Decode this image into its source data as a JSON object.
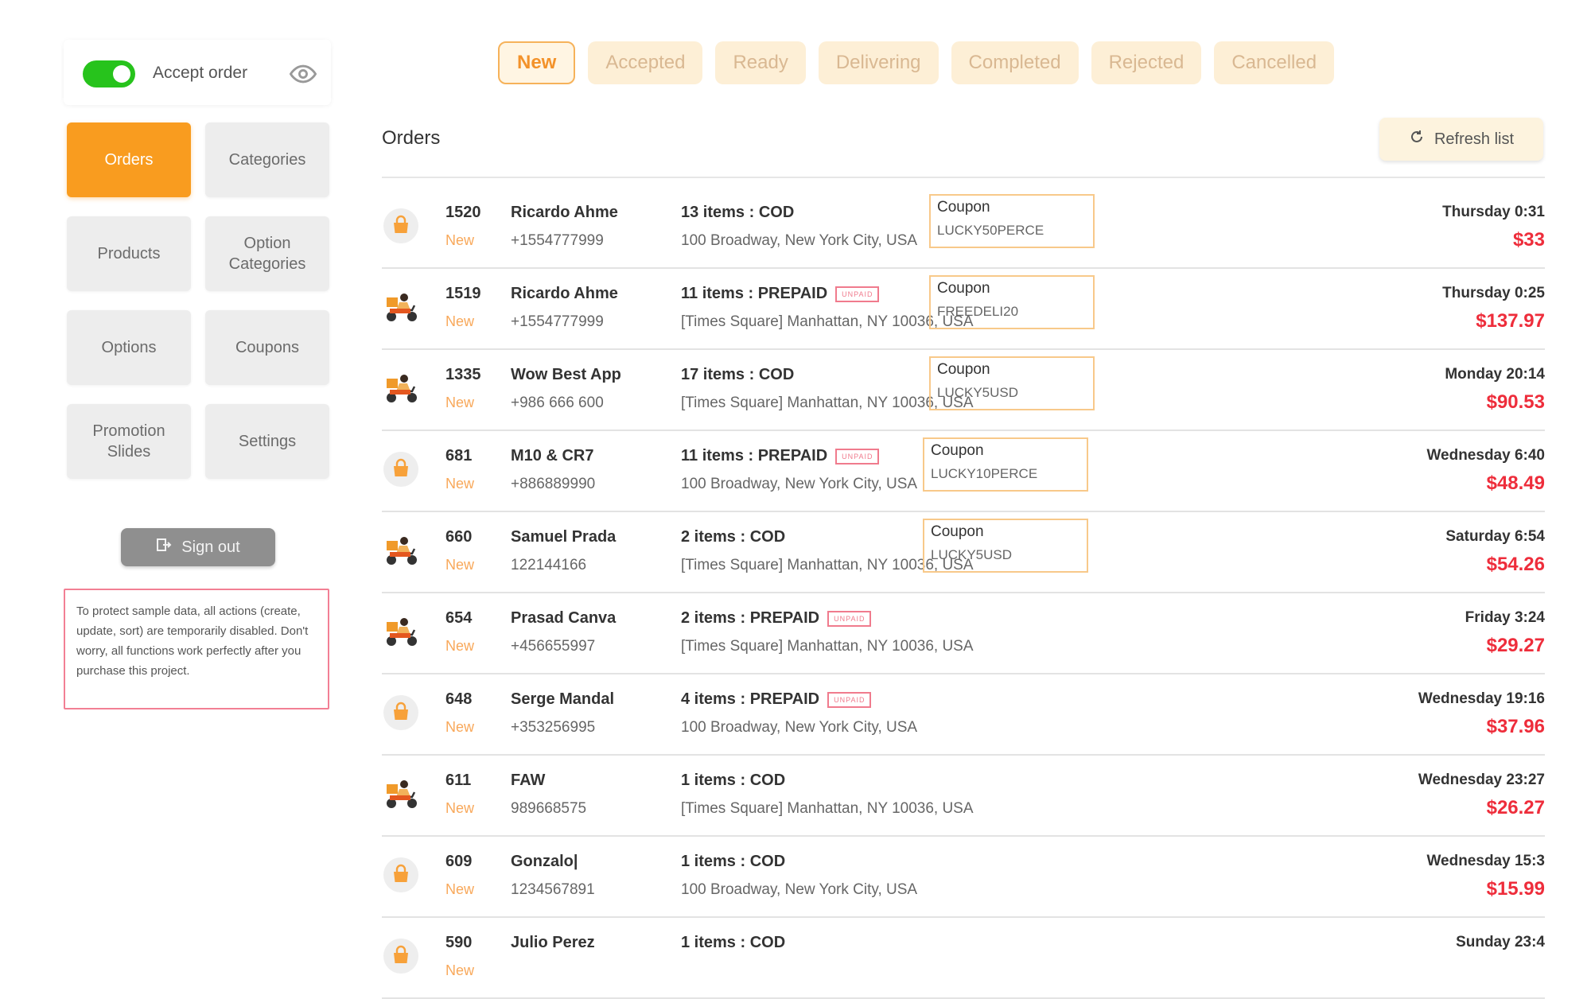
{
  "sidebar": {
    "accept_label": "Accept order",
    "accept_on": true,
    "menu": [
      {
        "label": "Orders",
        "active": true
      },
      {
        "label": "Categories",
        "active": false
      },
      {
        "label": "Products",
        "active": false
      },
      {
        "label": "Option\nCategories",
        "active": false
      },
      {
        "label": "Options",
        "active": false
      },
      {
        "label": "Coupons",
        "active": false
      },
      {
        "label": "Promotion\nSlides",
        "active": false
      },
      {
        "label": "Settings",
        "active": false
      }
    ],
    "signout_label": "Sign out",
    "notice": "To protect sample data, all actions (create, update, sort) are temporarily disabled. Don't worry, all functions work perfectly after you purchase this project."
  },
  "tabs": [
    {
      "label": "New",
      "active": true
    },
    {
      "label": "Accepted",
      "active": false
    },
    {
      "label": "Ready",
      "active": false
    },
    {
      "label": "Delivering",
      "active": false
    },
    {
      "label": "Completed",
      "active": false
    },
    {
      "label": "Rejected",
      "active": false
    },
    {
      "label": "Cancelled",
      "active": false
    }
  ],
  "main": {
    "title": "Orders",
    "refresh_label": "Refresh list",
    "unpaid_label": "UNPAID",
    "coupon_label": "Coupon"
  },
  "colors": {
    "accent": "#f99c1f",
    "price": "#ee2d3b",
    "toggle": "#27c31c"
  },
  "orders": [
    {
      "id": "1520",
      "status": "New",
      "name": "Ricardo Ahme",
      "phone": "+1554777999",
      "items": "13 items : COD",
      "unpaid": false,
      "address": "100 Broadway, New York City, USA",
      "coupon": "LUCKY50PERCE",
      "time": "Thursday 0:31",
      "amount": "$33",
      "icon": "bag-icon"
    },
    {
      "id": "1519",
      "status": "New",
      "name": "Ricardo Ahme",
      "phone": "+1554777999",
      "items": "11 items : PREPAID",
      "unpaid": true,
      "address": "[Times Square] Manhattan, NY 10036, USA",
      "coupon": "FREEDELI20",
      "time": "Thursday 0:25",
      "amount": "$137.97",
      "icon": "delivery-scooter-icon"
    },
    {
      "id": "1335",
      "status": "New",
      "name": "Wow Best App",
      "phone": "+986 666 600",
      "items": "17 items : COD",
      "unpaid": false,
      "address": "[Times Square] Manhattan, NY 10036, USA",
      "coupon": "LUCKY5USD",
      "time": "Monday 20:14",
      "amount": "$90.53",
      "icon": "delivery-scooter-icon"
    },
    {
      "id": "681",
      "status": "New",
      "name": "M10 & CR7",
      "phone": "+886889990",
      "items": "11 items : PREPAID",
      "unpaid": true,
      "address": "100 Broadway, New York City, USA",
      "coupon": "LUCKY10PERCE",
      "time": "Wednesday 6:40",
      "amount": "$48.49",
      "icon": "bag-icon"
    },
    {
      "id": "660",
      "status": "New",
      "name": "Samuel Prada",
      "phone": "122144166",
      "items": "2 items : COD",
      "unpaid": false,
      "address": "[Times Square] Manhattan, NY 10036, USA",
      "coupon": "LUCKY5USD",
      "time": "Saturday 6:54",
      "amount": "$54.26",
      "icon": "delivery-scooter-icon"
    },
    {
      "id": "654",
      "status": "New",
      "name": "Prasad Canva",
      "phone": "+456655997",
      "items": "2 items : PREPAID",
      "unpaid": true,
      "address": "[Times Square] Manhattan, NY 10036, USA",
      "coupon": "",
      "time": "Friday 3:24",
      "amount": "$29.27",
      "icon": "delivery-scooter-icon"
    },
    {
      "id": "648",
      "status": "New",
      "name": "Serge Mandal",
      "phone": "+353256995",
      "items": "4 items : PREPAID",
      "unpaid": true,
      "address": "100 Broadway, New York City, USA",
      "coupon": "",
      "time": "Wednesday 19:16",
      "amount": "$37.96",
      "icon": "bag-icon"
    },
    {
      "id": "611",
      "status": "New",
      "name": "FAW",
      "phone": "989668575",
      "items": "1 items : COD",
      "unpaid": false,
      "address": "[Times Square] Manhattan, NY 10036, USA",
      "coupon": "",
      "time": "Wednesday 23:27",
      "amount": "$26.27",
      "icon": "delivery-scooter-icon"
    },
    {
      "id": "609",
      "status": "New",
      "name": "Gonzalo|",
      "phone": "1234567891",
      "items": "1 items : COD",
      "unpaid": false,
      "address": "100 Broadway, New York City, USA",
      "coupon": "",
      "time": "Wednesday 15:3",
      "amount": "$15.99",
      "icon": "bag-icon"
    },
    {
      "id": "590",
      "status": "New",
      "name": "Julio Perez",
      "phone": "",
      "items": "1 items : COD",
      "unpaid": false,
      "address": "",
      "coupon": "",
      "time": "Sunday 23:4",
      "amount": "",
      "icon": "bag-icon"
    }
  ]
}
